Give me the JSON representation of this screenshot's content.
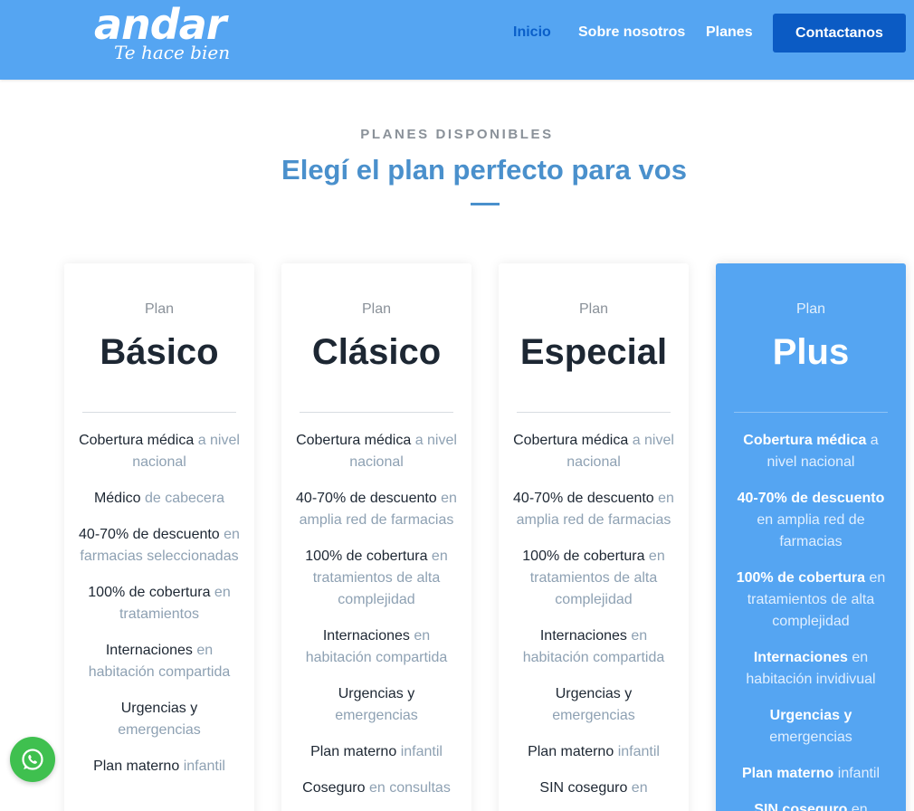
{
  "header": {
    "logo_word": "andar",
    "logo_tagline": "Te hace bien",
    "nav": [
      "Inicio",
      "Sobre nosotros",
      "Planes"
    ],
    "cta_label": "Contactanos"
  },
  "section": {
    "eyebrow": "PLANES DISPONIBLES",
    "heading": "Elegí el plan perfecto para vos"
  },
  "plans": [
    {
      "label": "Plan",
      "name": "Básico",
      "features": [
        {
          "bold": "Cobertura médica",
          "rest": "a nivel nacional"
        },
        {
          "bold": "Médico",
          "rest": "de cabecera"
        },
        {
          "bold": "40-70% de descuento",
          "rest": "en farmacias seleccionadas"
        },
        {
          "bold": "100% de cobertura",
          "rest": "en tratamientos"
        },
        {
          "bold": "Internaciones",
          "rest": "en habitación compartida"
        },
        {
          "bold": "Urgencias y",
          "rest": "emergencias"
        },
        {
          "bold": "Plan materno",
          "rest": "infantil"
        }
      ]
    },
    {
      "label": "Plan",
      "name": "Clásico",
      "features": [
        {
          "bold": "Cobertura médica",
          "rest": "a nivel nacional"
        },
        {
          "bold": "40-70% de descuento",
          "rest": "en amplia red de farmacias"
        },
        {
          "bold": "100% de cobertura",
          "rest": "en tratamientos de alta complejidad"
        },
        {
          "bold": "Internaciones",
          "rest": "en habitación compartida"
        },
        {
          "bold": "Urgencias y",
          "rest": "emergencias"
        },
        {
          "bold": "Plan materno",
          "rest": "infantil"
        },
        {
          "bold": "Coseguro",
          "rest": "en consultas"
        }
      ]
    },
    {
      "label": "Plan",
      "name": "Especial",
      "features": [
        {
          "bold": "Cobertura médica",
          "rest": "a nivel nacional"
        },
        {
          "bold": "40-70% de descuento",
          "rest": "en amplia red de farmacias"
        },
        {
          "bold": "100% de cobertura",
          "rest": "en tratamientos de alta complejidad"
        },
        {
          "bold": "Internaciones",
          "rest": "en habitación compartida"
        },
        {
          "bold": "Urgencias y",
          "rest": "emergencias"
        },
        {
          "bold": "Plan materno",
          "rest": "infantil"
        },
        {
          "bold": "SIN coseguro",
          "rest": "en"
        }
      ]
    },
    {
      "label": "Plan",
      "name": "Plus",
      "features": [
        {
          "bold": "Cobertura médica",
          "rest": "a nivel nacional"
        },
        {
          "bold": "40-70% de descuento",
          "rest": "en amplia red de farmacias"
        },
        {
          "bold": "100% de cobertura",
          "rest": "en tratamientos de alta complejidad"
        },
        {
          "bold": "Internaciones",
          "rest": "en habitación invidivual"
        },
        {
          "bold": "Urgencias y",
          "rest": "emergencias"
        },
        {
          "bold": "Plan materno",
          "rest": "infantil"
        },
        {
          "bold": "SIN coseguro",
          "rest": "en"
        }
      ]
    }
  ],
  "colors": {
    "header_bg": "#55a5f2",
    "accent": "#4a90cc",
    "cta_bg": "#0b5bc4",
    "whatsapp": "#3fc04f"
  },
  "icons": {
    "floating_button": "whatsapp-icon"
  }
}
